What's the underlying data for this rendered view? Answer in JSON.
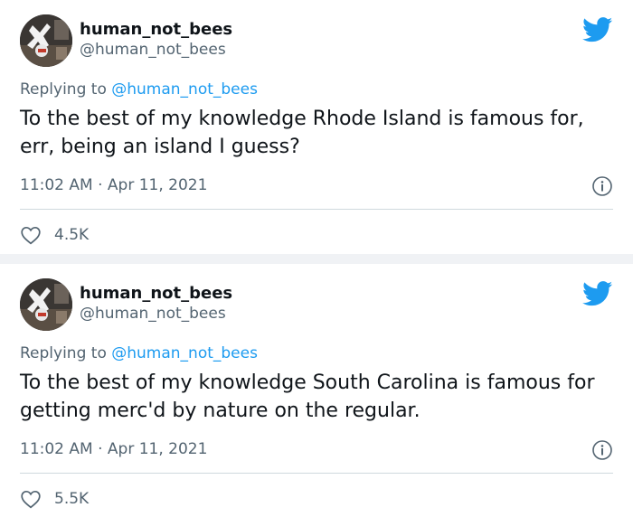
{
  "tweets": [
    {
      "display_name": "human_not_bees",
      "handle": "@human_not_bees",
      "replying_prefix": "Replying to ",
      "replying_to": "@human_not_bees",
      "text": "To the best of my knowledge Rhode Island is famous for, err, being an island I guess?",
      "timestamp": "11:02 AM · Apr 11, 2021",
      "likes": "4.5K"
    },
    {
      "display_name": "human_not_bees",
      "handle": "@human_not_bees",
      "replying_prefix": "Replying to ",
      "replying_to": "@human_not_bees",
      "text": "To the best of my knowledge South Carolina is famous for getting merc'd by nature on the regular.",
      "timestamp": "11:02 AM · Apr 11, 2021",
      "likes": "5.5K"
    }
  ],
  "icons": {
    "brand": "twitter-bird-icon",
    "info": "info-icon",
    "like": "heart-icon"
  },
  "colors": {
    "brand": "#1d9bf0",
    "text": "#0f1419",
    "muted": "#536471",
    "divider": "#cfd9de",
    "background": "#f0f2f5"
  }
}
